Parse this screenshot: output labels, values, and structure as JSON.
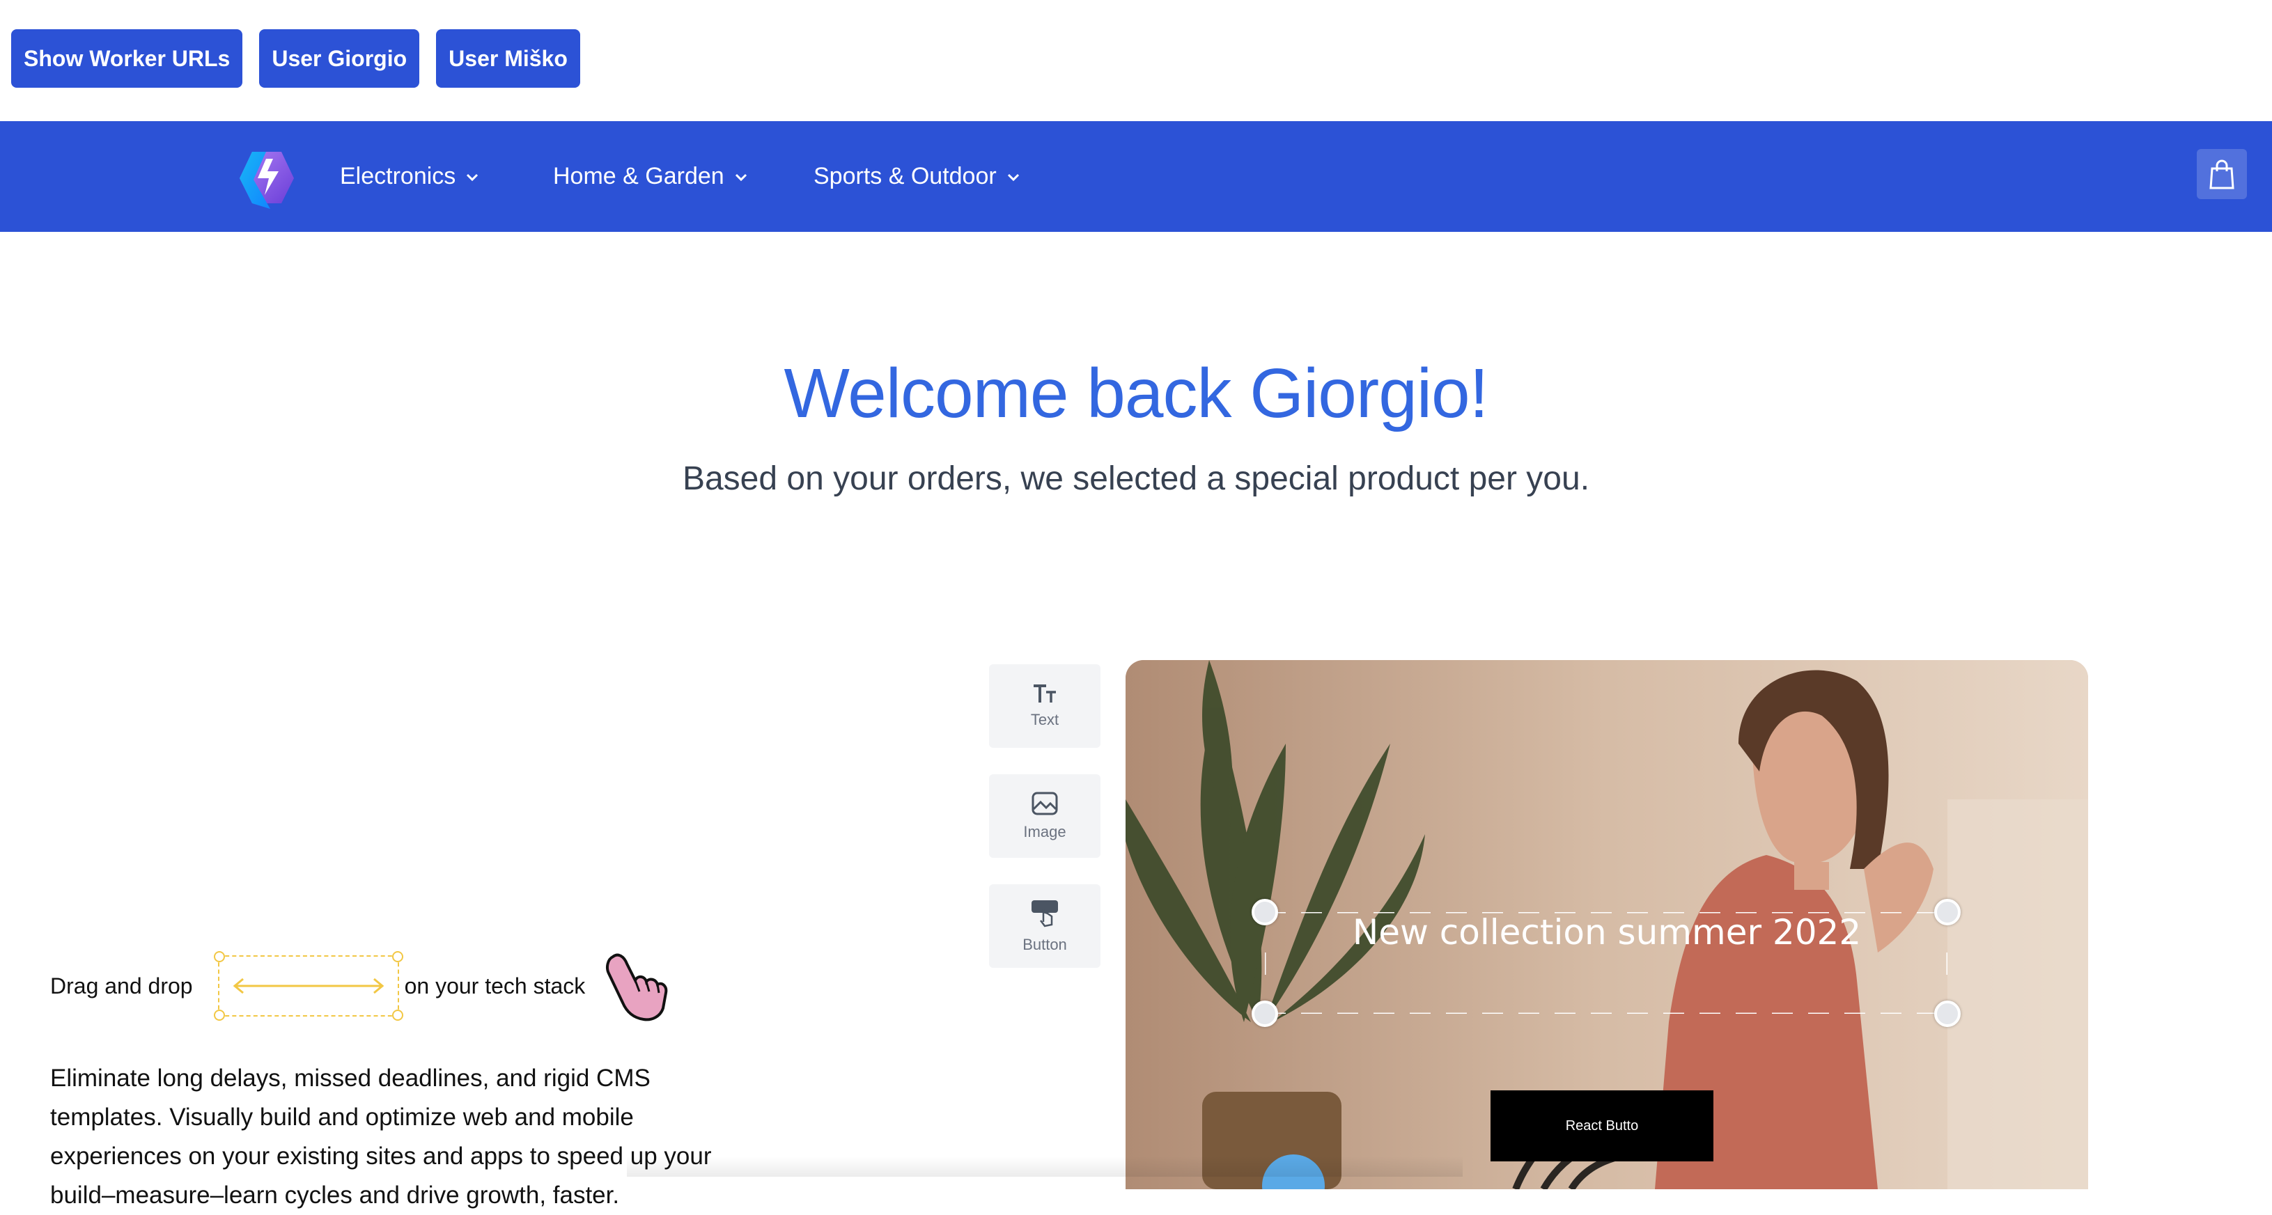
{
  "demo_buttons": [
    "Show Worker URLs",
    "User Giorgio",
    "User Miško"
  ],
  "nav": {
    "items": [
      "Electronics",
      "Home & Garden",
      "Sports & Outdoor"
    ]
  },
  "hero": {
    "title": "Welcome back Giorgio!",
    "subtitle": "Based on your orders, we selected a special product per you."
  },
  "drag": {
    "prefix": "Drag and drop",
    "suffix": "on your tech stack",
    "description": "Eliminate long delays, missed deadlines, and rigid CMS templates. Visually build and optimize web and mobile experiences on your existing sites and apps to speed up your build–measure–learn cycles and drive growth, faster."
  },
  "tools": [
    "Text",
    "Image",
    "Button"
  ],
  "card": {
    "headline": "New collection summer 2022",
    "button_label": "React Butto"
  },
  "colors": {
    "brand": "#2c52d6",
    "title": "#3367e0",
    "drag_accent": "#f2c744"
  }
}
